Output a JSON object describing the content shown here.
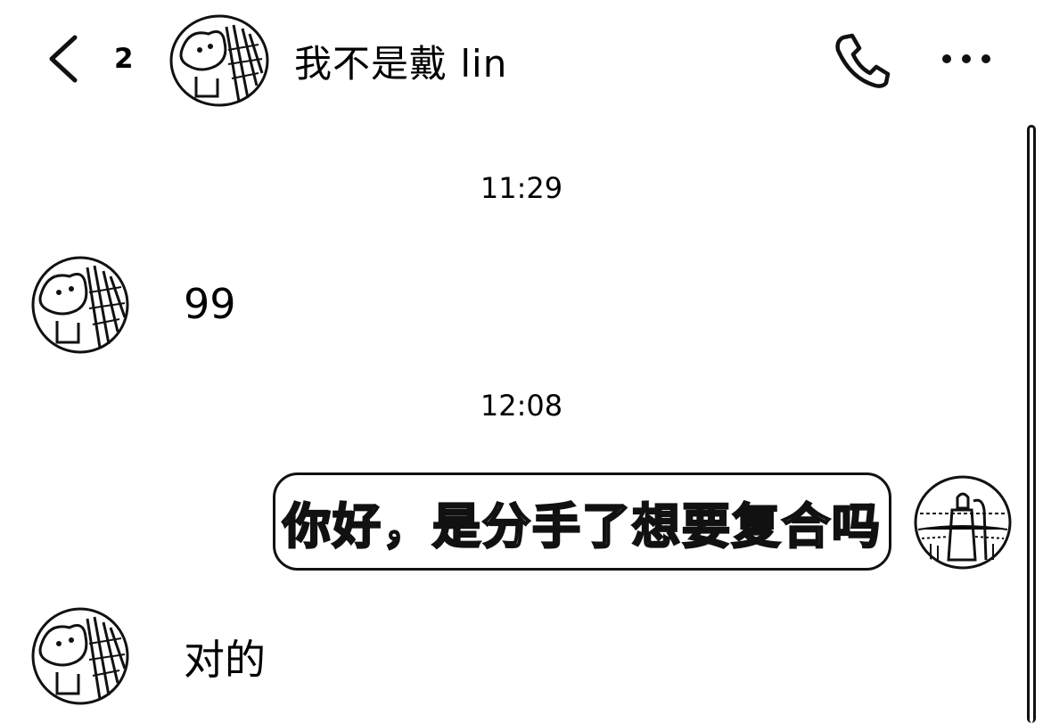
{
  "header": {
    "unread_count": "2",
    "contact_name": "我不是戴 lin"
  },
  "messages": [
    {
      "type": "timestamp",
      "text": "11:29"
    },
    {
      "type": "received",
      "text": "99"
    },
    {
      "type": "timestamp",
      "text": "12:08"
    },
    {
      "type": "sent",
      "text": "你好，是分手了想要复合吗"
    },
    {
      "type": "received",
      "text": "对的"
    }
  ],
  "icons": {
    "back": "chevron-left-icon",
    "call": "phone-icon",
    "more": "more-dots-icon"
  }
}
